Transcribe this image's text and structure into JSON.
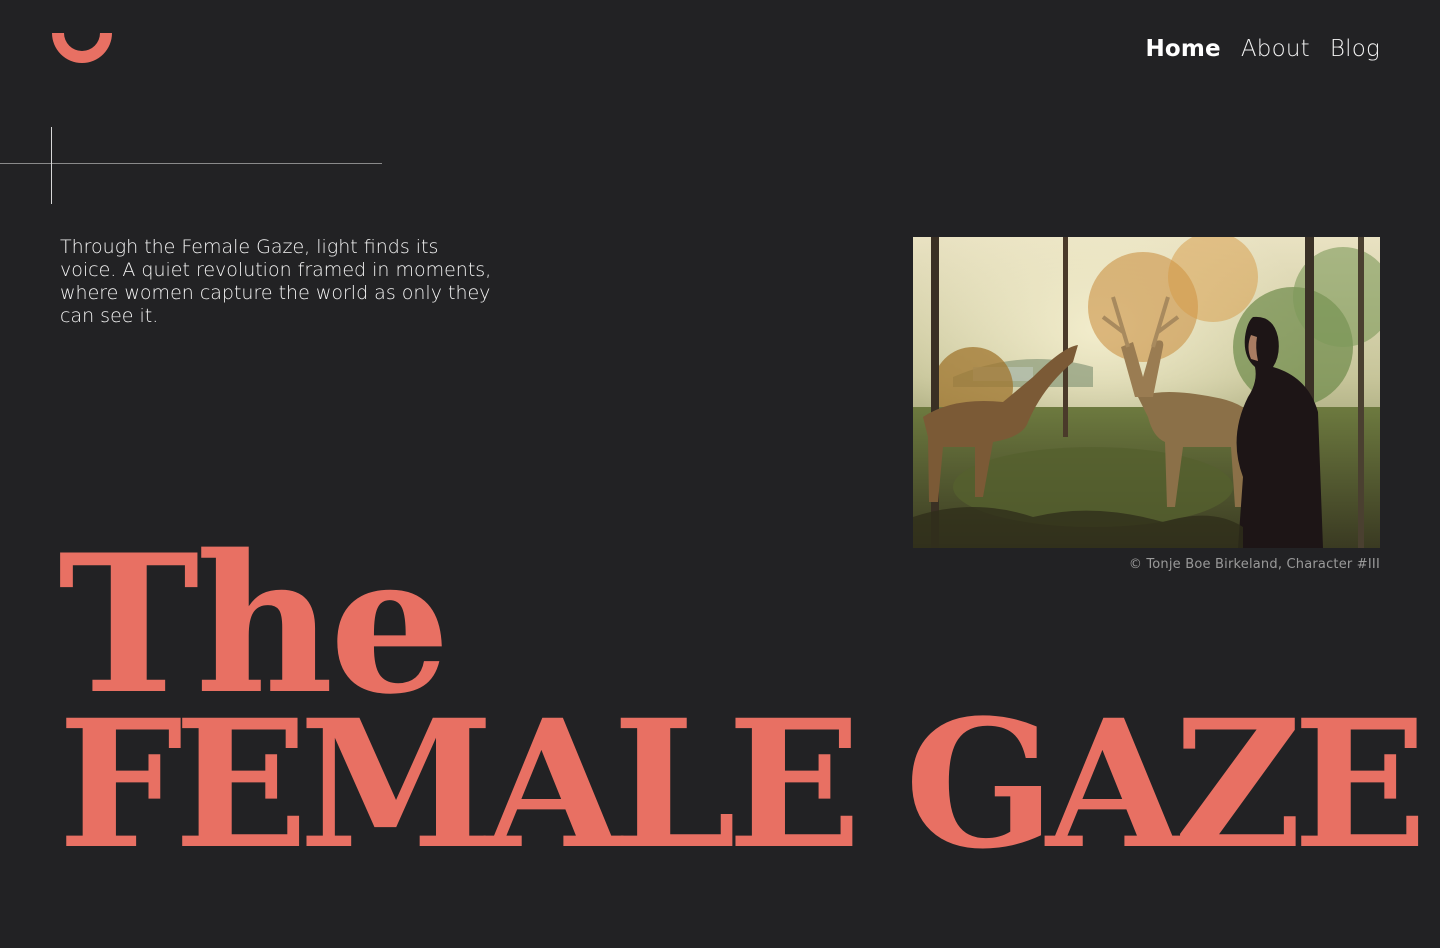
{
  "brand": {
    "logo_icon": "half-ring-logo-icon",
    "accent_color": "#e87063"
  },
  "nav": {
    "items": [
      {
        "label": "Home",
        "active": true
      },
      {
        "label": "About",
        "active": false
      },
      {
        "label": "Blog",
        "active": false
      }
    ]
  },
  "hero": {
    "intro": "Through the Female Gaze, light finds its voice. A quiet revolution framed in moments, where women capture the world as only they can see it.",
    "photo_icon": "woman-with-deer-in-autumn-forest-photo",
    "photo_credit": "© Tonje Boe Birkeland, Character #III",
    "title_line1": "The",
    "title_line2": "FEMALE GAZE"
  },
  "colors": {
    "background": "#222224",
    "text": "#ffffff",
    "accent": "#e87063",
    "muted": "#9a9a9a"
  }
}
